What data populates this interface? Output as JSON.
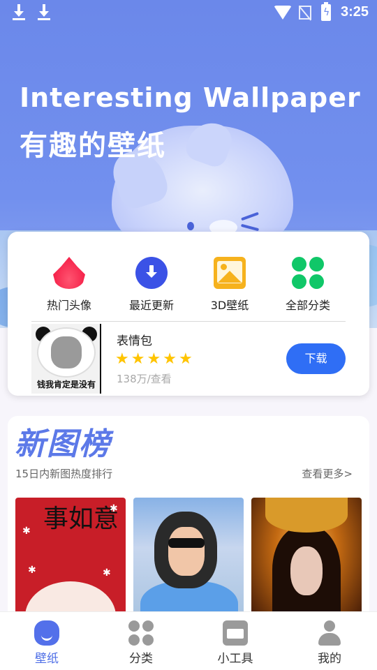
{
  "status_bar": {
    "time": "3:25"
  },
  "banner": {
    "title_en": "Interesting Wallpaper",
    "title_cn": "有趣的壁纸"
  },
  "features": [
    {
      "label": "热门头像",
      "icon": "fire-icon"
    },
    {
      "label": "最近更新",
      "icon": "download-circle-icon"
    },
    {
      "label": "3D壁纸",
      "icon": "image-icon"
    },
    {
      "label": "全部分类",
      "icon": "clover-grid-icon"
    }
  ],
  "featured_pack": {
    "thumb_caption": "钱我肯定是没有",
    "name": "表情包",
    "rating": 5,
    "star": "★",
    "views": "138万/查看",
    "download_label": "下载",
    "accent": "#2f6ef5"
  },
  "ranking": {
    "title": "新图榜",
    "subtitle": "15日内新图热度排行",
    "more_label": "查看更多>",
    "items": [
      {
        "caption": "事如意"
      },
      {
        "caption": ""
      },
      {
        "caption": ""
      }
    ]
  },
  "bottom_nav": [
    {
      "label": "壁纸",
      "active": true
    },
    {
      "label": "分类",
      "active": false
    },
    {
      "label": "小工具",
      "active": false
    },
    {
      "label": "我的",
      "active": false
    }
  ],
  "colors": {
    "banner": "#6b88ea",
    "active_nav": "#4f6fe6",
    "ranking_title": "#5c79e8"
  }
}
